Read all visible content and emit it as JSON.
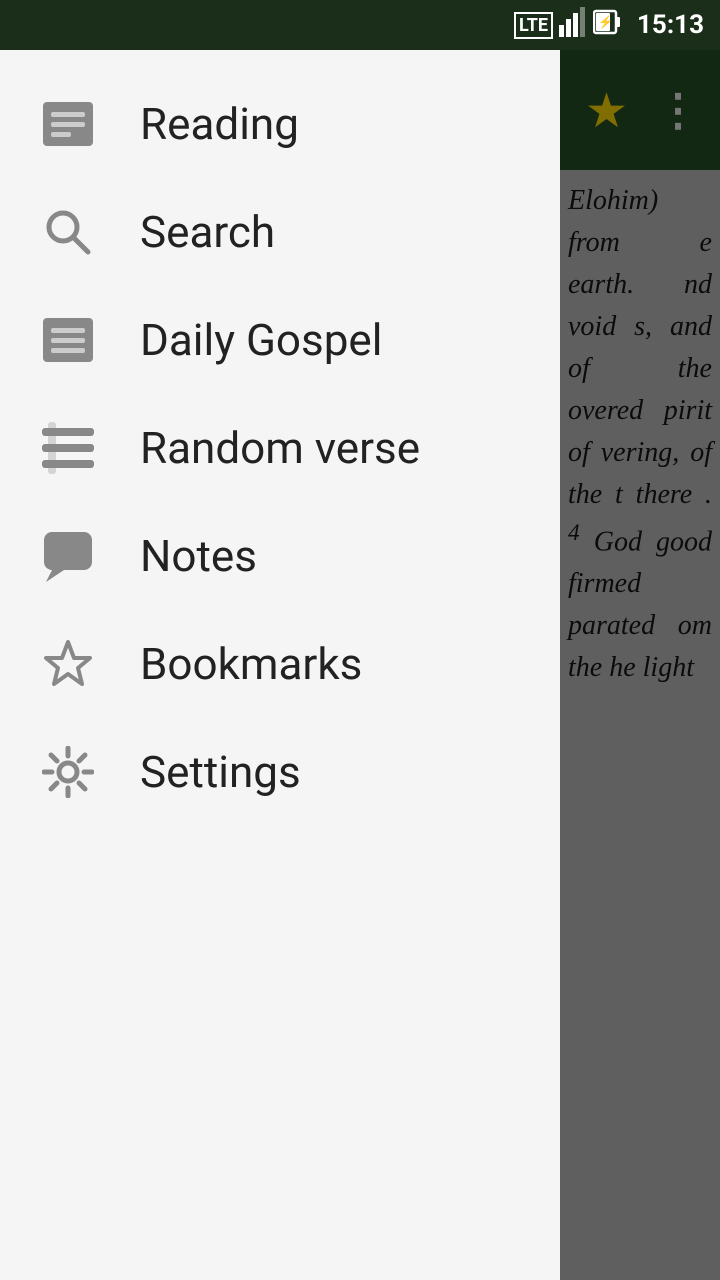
{
  "statusBar": {
    "time": "15:13",
    "lteLabel": "LTE"
  },
  "topBar": {
    "starLabel": "★",
    "moreLabel": "⋮"
  },
  "bibleText": {
    "content": "Elohim) from e earth. nd void s, and of the overed pirit of vering, of the t there . 4 God good firmed parated om the he light"
  },
  "drawer": {
    "items": [
      {
        "id": "reading",
        "label": "Reading",
        "icon": "book-icon"
      },
      {
        "id": "search",
        "label": "Search",
        "icon": "search-icon"
      },
      {
        "id": "daily-gospel",
        "label": "Daily Gospel",
        "icon": "newspaper-icon"
      },
      {
        "id": "random-verse",
        "label": "Random verse",
        "icon": "list-icon"
      },
      {
        "id": "notes",
        "label": "Notes",
        "icon": "chat-icon"
      },
      {
        "id": "bookmarks",
        "label": "Bookmarks",
        "icon": "star-icon"
      },
      {
        "id": "settings",
        "label": "Settings",
        "icon": "gear-icon"
      }
    ]
  }
}
